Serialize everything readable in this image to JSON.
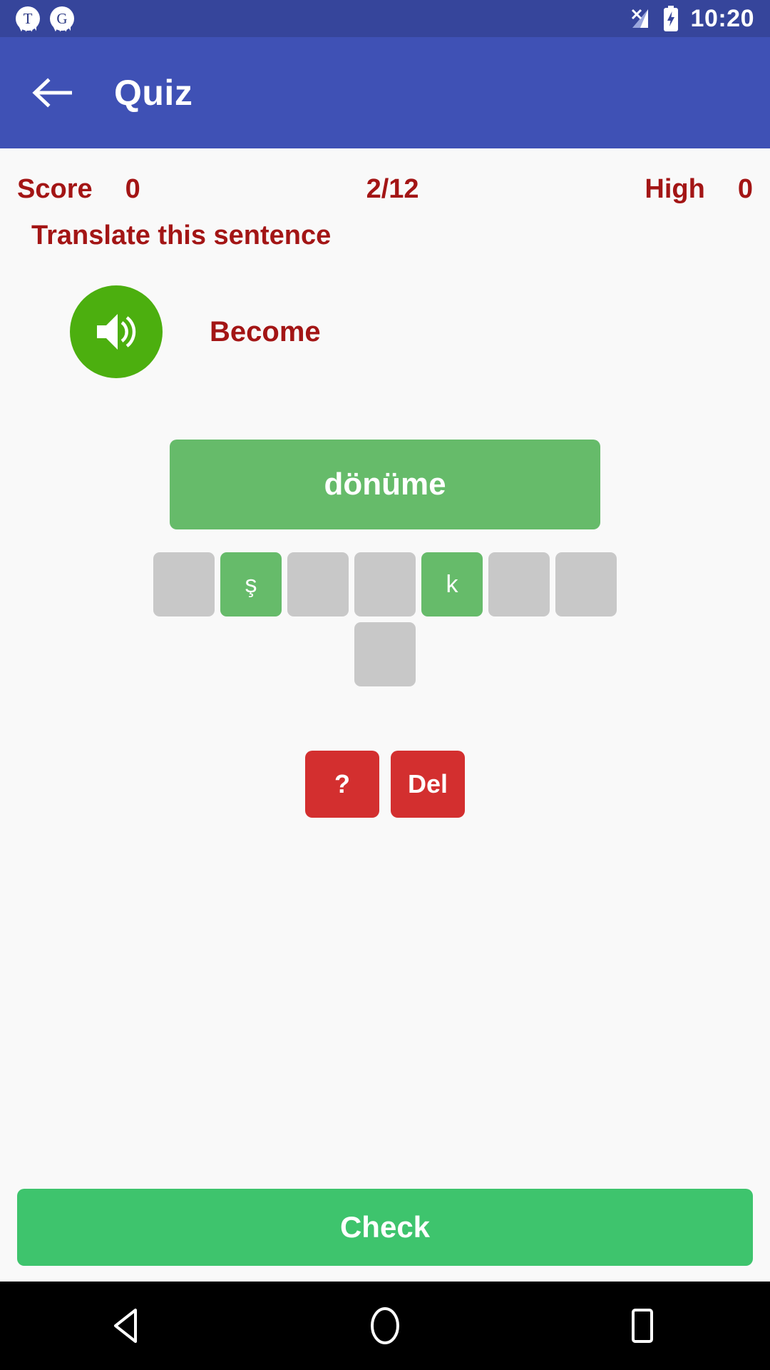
{
  "status_bar": {
    "notifications": [
      {
        "icon": "notification-badge-t-icon",
        "label": "T"
      },
      {
        "icon": "notification-badge-g-icon",
        "label": "G"
      }
    ],
    "signal_icon": "signal-no-sim-icon",
    "battery_icon": "battery-charging-icon",
    "time": "10:20",
    "background": "#36459b"
  },
  "app_bar": {
    "back_icon": "back-arrow-icon",
    "title": "Quiz",
    "background": "#3f51b5"
  },
  "scoreboard": {
    "score_label": "Score",
    "score_value": "0",
    "progress": "2/12",
    "high_label": "High",
    "high_value": "0",
    "text_color": "#a31515"
  },
  "quiz": {
    "instruction": "Translate this sentence",
    "audio_icon": "speaker-volume-icon",
    "audio_button_color": "#4caf0f",
    "source_word": "Become",
    "answer_text": "dönüme",
    "answer_color": "#66bb6a",
    "tile_rows": [
      [
        {
          "letter": "",
          "filled": false
        },
        {
          "letter": "ş",
          "filled": true
        },
        {
          "letter": "",
          "filled": false
        },
        {
          "letter": "",
          "filled": false
        },
        {
          "letter": "k",
          "filled": true
        },
        {
          "letter": "",
          "filled": false
        },
        {
          "letter": "",
          "filled": false
        }
      ],
      [
        {
          "letter": "",
          "filled": false
        }
      ]
    ],
    "tile_empty_color": "#c8c8c8",
    "tile_filled_color": "#66bb6a",
    "hint_label": "?",
    "delete_label": "Del",
    "action_color": "#d32f2f",
    "check_label": "Check",
    "check_color": "#3ec46d"
  },
  "nav_bar": {
    "back_icon": "nav-back-triangle-icon",
    "home_icon": "nav-home-circle-icon",
    "recents_icon": "nav-recents-square-icon",
    "background": "#000000"
  }
}
